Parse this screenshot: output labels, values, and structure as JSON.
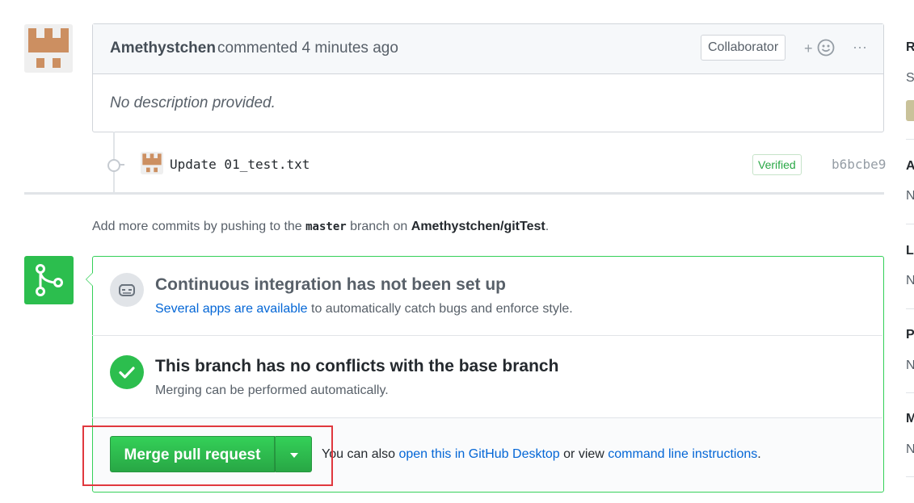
{
  "comment": {
    "author": "Amethystchen",
    "action": "commented 4 minutes ago",
    "role_badge": "Collaborator",
    "reaction_label": "+",
    "more_label": "···",
    "body": "No description provided."
  },
  "commit": {
    "message": "Update 01_test.txt",
    "verified_label": "Verified",
    "sha": "b6bcbe9"
  },
  "hint": {
    "prefix": "Add more commits by pushing to the ",
    "branch": "master",
    "middle": " branch on ",
    "repo": "Amethystchen/gitTest",
    "suffix": "."
  },
  "ci": {
    "title": "Continuous integration has not been set up",
    "link_text": "Several apps are available",
    "rest": " to automatically catch bugs and enforce style."
  },
  "conflicts": {
    "title": "This branch has no conflicts with the base branch",
    "desc": "Merging can be performed automatically."
  },
  "merge": {
    "button_label": "Merge pull request",
    "text_prefix": "You can also ",
    "desktop_link": "open this in GitHub Desktop",
    "text_middle": " or view ",
    "cli_link": "command line instructions",
    "text_suffix": "."
  },
  "sidebar": {
    "letters": [
      "R",
      "S",
      "A",
      "N",
      "L",
      "N",
      "P",
      "N",
      "M",
      "N"
    ]
  },
  "colors": {
    "accent_green": "#2cbe4e",
    "link_blue": "#0366d6",
    "highlight_red": "#e0383e"
  }
}
